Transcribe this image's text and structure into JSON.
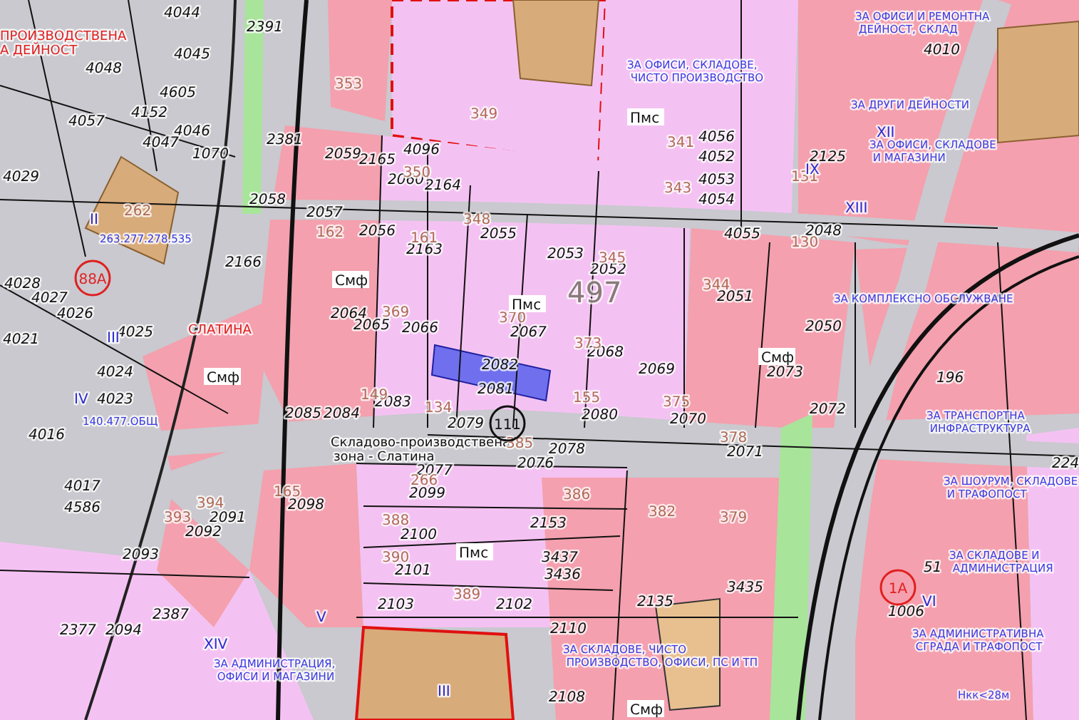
{
  "map": {
    "block_number": "497",
    "zone_title": [
      "Складово-производствена",
      "зона - Слатина"
    ],
    "zone_codes": [
      "Смф",
      "Пмс",
      "Смф",
      "Пмс",
      "Смф",
      "Пмс",
      "Смф"
    ],
    "zone_labels": [
      "ПРОИЗВОДСТВЕНА",
      "А ДЕЙНОСТ",
      "СЛАТИНА"
    ],
    "markers": [
      "88А",
      "111",
      "1А"
    ],
    "parcel_numbers": [
      "4044",
      "4045",
      "4048",
      "4605",
      "4152",
      "4057",
      "4046",
      "4047",
      "1070",
      "4029",
      "2391",
      "2381",
      "2058",
      "2057",
      "2059",
      "2165",
      "2060",
      "2164",
      "4096",
      "2056",
      "2163",
      "2055",
      "2053",
      "2052",
      "2051",
      "2125",
      "2048",
      "2050",
      "4052",
      "4053",
      "4054",
      "4055",
      "4056",
      "4010",
      "2166",
      "2064",
      "2065",
      "2066",
      "2067",
      "2068",
      "2069",
      "2080",
      "2070",
      "2071",
      "2072",
      "2073",
      "2083",
      "2085",
      "2084",
      "2082",
      "2081",
      "2079",
      "2077",
      "2076",
      "2078",
      "2098",
      "2099",
      "2100",
      "2101",
      "2103",
      "2102",
      "2153",
      "2091",
      "2092",
      "2093",
      "2377",
      "2094",
      "2387",
      "2110",
      "2108",
      "4028",
      "4027",
      "4026",
      "4025",
      "4021",
      "4024",
      "4023",
      "4016",
      "4017",
      "4586",
      "3437",
      "3436",
      "3435",
      "1006",
      "51",
      "196",
      "224",
      "2135"
    ],
    "lot_numbers": [
      "349",
      "353",
      "350",
      "348",
      "162",
      "161",
      "345",
      "344",
      "369",
      "370",
      "373",
      "155",
      "375",
      "378",
      "266",
      "388",
      "390",
      "389",
      "385",
      "386",
      "134",
      "149",
      "165",
      "394",
      "393",
      "262",
      "382",
      "379",
      "131",
      "130",
      "341",
      "343"
    ],
    "roman_numerals": [
      "II",
      "III",
      "IV",
      "V",
      "VI",
      "XII",
      "XIII",
      "XIV",
      "IX",
      "III"
    ],
    "annotations": [
      "ЗА ОФИСИ И РЕМОНТНА ДЕЙНОСТ, СКЛАД",
      "ЗА ОФИСИ, СКЛАДОВЕ, ЧИСТО ПРОИЗВОДСТВО",
      "ЗА ДРУГИ ДЕЙНОСТИ",
      "ЗА ОФИСИ, СКЛАДОВЕ И МАГАЗИНИ",
      "ЗА КОМПЛЕКСНО ОБСЛУЖВАНЕ",
      "ЗА СКЛАДОВЕ, ЧИСТО ПРОИЗВОДСТВО, ОФИСИ, ПС И ТП",
      "ЗА ТРАНСПОРТНА ИНФРАСТРУКТУРА",
      "ЗА ШОУРУМ, СКЛАДОВЕ И ТРАФОПОСТ",
      "ЗА СКЛАДОВЕ И АДМИНИСТРАЦИЯ",
      "ЗА АДМИНИСТРАТИВНА СГРАДА И ТРАФОПОСТ",
      "ЗА АДМИНИСТРАЦИЯ, ОФИСИ И МАГАЗИНИ",
      "Нкк<28м",
      "263.277.278.535",
      "140.477.ОБЩ"
    ]
  }
}
